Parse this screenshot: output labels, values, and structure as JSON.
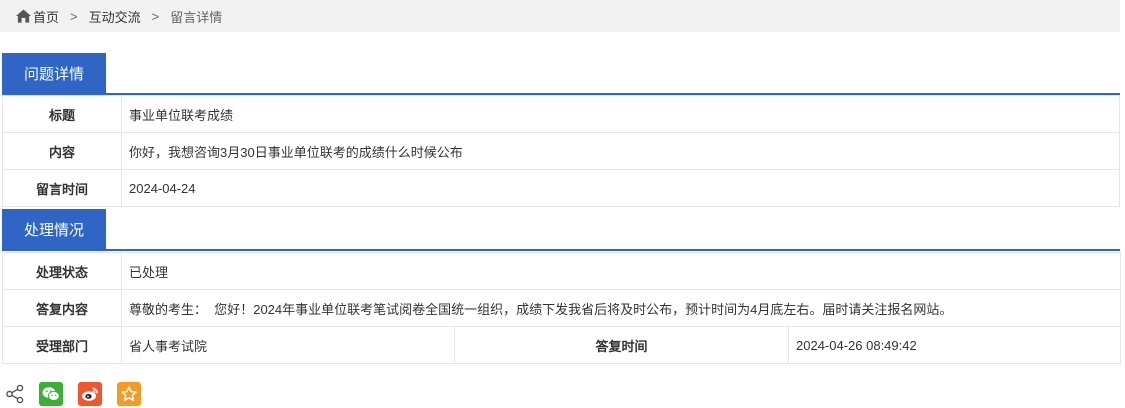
{
  "breadcrumb": {
    "home": "首页",
    "sep1": ">",
    "item1": "互动交流",
    "sep2": ">",
    "current": "留言详情"
  },
  "question_section": {
    "title": "问题详情",
    "rows": [
      {
        "label": "标题",
        "value": "事业单位联考成绩"
      },
      {
        "label": "内容",
        "value": "你好，我想咨询3月30日事业单位联考的成绩什么时候公布"
      },
      {
        "label": "留言时间",
        "value": "2024-04-24"
      }
    ]
  },
  "handling_section": {
    "title": "处理情况",
    "status_label": "处理状态",
    "status_value": "已处理",
    "reply_label": "答复内容",
    "reply_value": "尊敬的考生：  您好！2024年事业单位联考笔试阅卷全国统一组织，成绩下发我省后将及时公布，预计时间为4月底左右。届时请关注报名网站。",
    "dept_label": "受理部门",
    "dept_value": "省人事考试院",
    "reply_time_label": "答复时间",
    "reply_time_value": "2024-04-26 08:49:42"
  },
  "share": {
    "icons": [
      "share-icon",
      "wechat-icon",
      "weibo-icon",
      "favorite-icon"
    ]
  },
  "colors": {
    "accent": "#2f66c5",
    "breadcrumb_bg": "#f2f2f2",
    "wechat": "#3cb034",
    "weibo": "#f3562e",
    "favorite": "#f59a23"
  }
}
